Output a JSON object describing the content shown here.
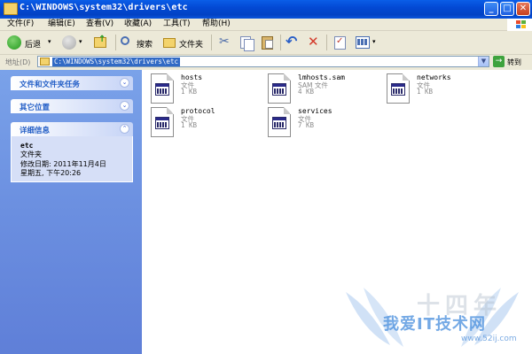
{
  "window": {
    "title": "C:\\WINDOWS\\system32\\drivers\\etc",
    "buttons": {
      "minimize": "_",
      "maximize": "□",
      "close": "✕"
    }
  },
  "menu": [
    "文件(F)",
    "编辑(E)",
    "查看(V)",
    "收藏(A)",
    "工具(T)",
    "帮助(H)"
  ],
  "toolbar": {
    "back": "后退",
    "search": "搜索",
    "folders": "文件夹"
  },
  "address": {
    "label": "地址(D)",
    "value": "C:\\WINDOWS\\system32\\drivers\\etc",
    "go": "转到"
  },
  "sidebar": {
    "tasks_title": "文件和文件夹任务",
    "other_title": "其它位置",
    "details_title": "详细信息",
    "details": {
      "name": "etc",
      "type": "文件夹",
      "modified": "修改日期: 2011年11月4日",
      "day_time": "星期五, 下午20:26"
    }
  },
  "files": [
    {
      "name": "hosts",
      "type": "文件",
      "size": "1 KB"
    },
    {
      "name": "lmhosts.sam",
      "type": "SAM 文件",
      "size": "4 KB"
    },
    {
      "name": "networks",
      "type": "文件",
      "size": "1 KB"
    },
    {
      "name": "protocol",
      "type": "文件",
      "size": "1 KB"
    },
    {
      "name": "services",
      "type": "文件",
      "size": "7 KB"
    }
  ],
  "watermark": {
    "brand": "我爱IT技术网",
    "site": "www.52ij.com",
    "grey": "十四年"
  },
  "colors": {
    "title_blue": "#0349d4",
    "sidebar_blue": "#6b8fe0",
    "selection": "#316ac5"
  }
}
